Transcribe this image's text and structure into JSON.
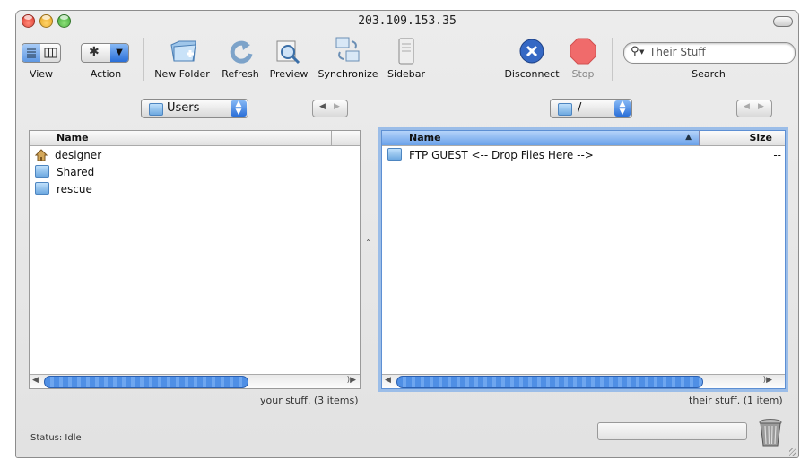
{
  "window": {
    "title": "203.109.153.35"
  },
  "toolbar": {
    "view_label": "View",
    "action_label": "Action",
    "new_folder_label": "New Folder",
    "refresh_label": "Refresh",
    "preview_label": "Preview",
    "synchronize_label": "Synchronize",
    "sidebar_label": "Sidebar",
    "disconnect_label": "Disconnect",
    "stop_label": "Stop",
    "search_label": "Search",
    "search_placeholder": "Their Stuff"
  },
  "local": {
    "location": "Users",
    "column_name": "Name",
    "items": [
      {
        "name": "designer",
        "icon": "home-folder-icon"
      },
      {
        "name": "Shared",
        "icon": "folder-icon"
      },
      {
        "name": "rescue",
        "icon": "folder-icon"
      }
    ],
    "status": "your stuff. (3 items)"
  },
  "remote": {
    "location": "/",
    "column_name": "Name",
    "column_size": "Size",
    "items": [
      {
        "name": "FTP GUEST <-- Drop Files Here -->",
        "size": "--",
        "icon": "folder-icon"
      }
    ],
    "status": "their stuff. (1 item)"
  },
  "status_bar": {
    "text": "Status: Idle"
  },
  "colors": {
    "accent": "#3b7fe0",
    "close": "#e6453a",
    "minimize": "#f0b429",
    "zoom": "#5cc14a",
    "stop": "#f06b6b"
  }
}
